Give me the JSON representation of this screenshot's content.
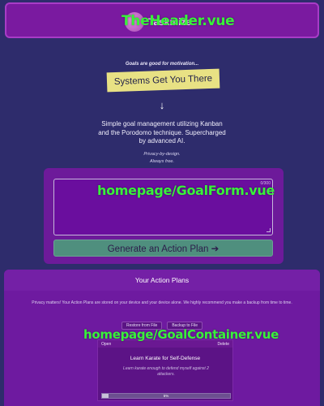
{
  "dev_labels": {
    "header": "TheHeader.vue",
    "goal_form": "homepage/GoalForm.vue",
    "goal_container": "homepage/GoalContainer.vue"
  },
  "header": {
    "logo_icon": "planet-logo-icon",
    "app_name": "Taskmize"
  },
  "hero": {
    "tagline": "Goals are good for motivation...",
    "headline": "Systems Get You There",
    "arrow": "↓",
    "description": "Simple goal management utilizing Kanban and the Porodomo technique. Supercharged by advanced AI.",
    "privacy_line1": "Privacy-by-design.",
    "privacy_line2": "Always free."
  },
  "goal_form": {
    "input_value": "",
    "char_count": "0/300",
    "generate_label": "Generate an Action Plan ➔"
  },
  "action_plans": {
    "title": "Your Action Plans",
    "privacy_note": "Privacy matters! Your Action Plans are stored on your device and your device alone. We highly recommend you make a backup from time to time.",
    "restore_label": "Restore from File",
    "backup_label": "Backup to File",
    "plans": [
      {
        "open_label": "Open",
        "delete_label": "Delete",
        "title": "Learn Karate for Self-Defense",
        "description": "Learn karate enough to defend myself against 2 attackers.",
        "progress": 0.05,
        "progress_text": "5%"
      }
    ]
  },
  "colors": {
    "page_bg": "#2e2c6c",
    "panel_bg": "#6d1a9a",
    "headline_bg": "#e8e184",
    "generate_btn": "#4f8f7e",
    "dev_label": "#38f23a"
  }
}
